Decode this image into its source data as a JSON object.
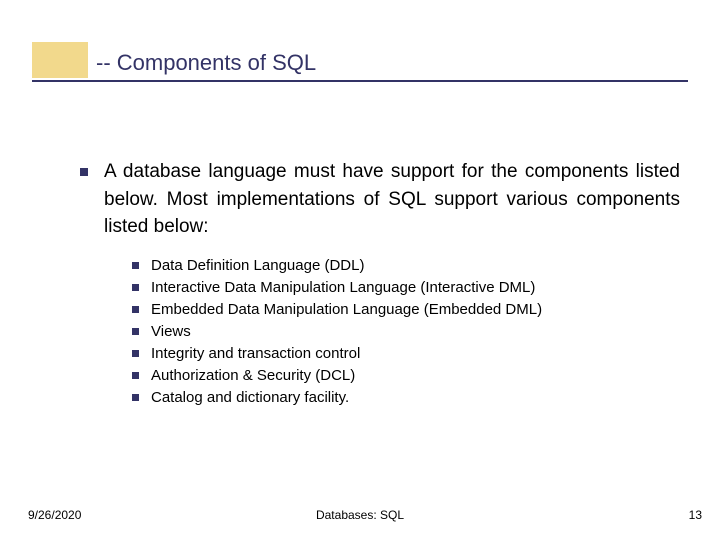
{
  "title": "-- Components of SQL",
  "main_text": "A database language must have support for the components listed below. Most implementations of SQL support various components listed below:",
  "sub_items": [
    "Data Definition Language (DDL)",
    "Interactive Data Manipulation Language (Interactive DML)",
    "Embedded Data Manipulation Language (Embedded DML)",
    "Views",
    "Integrity and transaction control",
    "Authorization & Security (DCL)",
    "Catalog and dictionary facility."
  ],
  "footer": {
    "date": "9/26/2020",
    "center": "Databases: SQL",
    "page": "13"
  },
  "colors": {
    "accent": "#333366",
    "highlight": "#f2d98c"
  }
}
